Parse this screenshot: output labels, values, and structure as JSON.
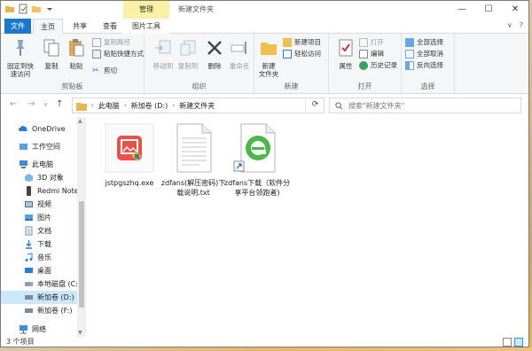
{
  "titlebar": {
    "manage_tab": "管理",
    "title": "新建文件夹",
    "minimize": "—",
    "maximize": "☐",
    "close": "✕"
  },
  "tabs": {
    "file": "文件",
    "home": "主页",
    "share": "共享",
    "view": "查看",
    "picture_tools": "图片工具"
  },
  "ribbon": {
    "clipboard": {
      "pin": "固定到快\n速访问",
      "copy": "复制",
      "paste": "粘贴",
      "copy_path": "复制路径",
      "paste_shortcut": "粘贴快捷方式",
      "cut": "剪切",
      "label": "剪贴板"
    },
    "organize": {
      "move_to": "移动到",
      "copy_to": "复制到",
      "delete": "删除",
      "rename": "重命名",
      "label": "组织"
    },
    "new": {
      "new_folder": "新建\n文件夹",
      "new_item": "新建项目",
      "easy_access": "轻松访问",
      "label": "新建"
    },
    "open": {
      "properties": "属性",
      "open": "打开",
      "edit": "编辑",
      "history": "历史记录",
      "label": "打开"
    },
    "select": {
      "select_all": "全部选择",
      "select_none": "全部取消",
      "invert": "反向选择",
      "label": "选择"
    }
  },
  "address": {
    "crumbs": [
      "此电脑",
      "新加卷 (D:)",
      "新建文件夹"
    ],
    "search_placeholder": "搜索\"新建文件夹\""
  },
  "nav": {
    "items": [
      {
        "label": "OneDrive",
        "icon": "cloud-icon"
      },
      {
        "label": "工作空间",
        "icon": "workspace-icon"
      },
      {
        "label": "此电脑",
        "icon": "computer-icon"
      },
      {
        "label": "3D 对象",
        "icon": "cube-icon"
      },
      {
        "label": "Redmi Note",
        "icon": "phone-icon"
      },
      {
        "label": "视频",
        "icon": "video-icon"
      },
      {
        "label": "图片",
        "icon": "picture-icon"
      },
      {
        "label": "文档",
        "icon": "document-icon"
      },
      {
        "label": "下载",
        "icon": "download-icon"
      },
      {
        "label": "音乐",
        "icon": "music-icon"
      },
      {
        "label": "桌面",
        "icon": "desktop-icon"
      },
      {
        "label": "本地磁盘 (C:)",
        "icon": "drive-icon"
      },
      {
        "label": "新加卷 (D:)",
        "icon": "drive-icon"
      },
      {
        "label": "新加卷 (F:)",
        "icon": "drive-icon"
      },
      {
        "label": "网络",
        "icon": "network-icon"
      }
    ]
  },
  "files": [
    {
      "name": "jstpgszhq.exe",
      "icon": "image-app-icon"
    },
    {
      "name": "zdfans(解压密码)下载说明.txt",
      "icon": "text-file-icon"
    },
    {
      "name": "zdfans下载（软件分享平台领跑者)",
      "icon": "ie-shortcut-icon"
    }
  ],
  "status": {
    "count": "3 个项目"
  },
  "colors": {
    "accent": "#1979ca",
    "manage_tab": "#fbf1a6",
    "selection": "#cce8ff"
  }
}
